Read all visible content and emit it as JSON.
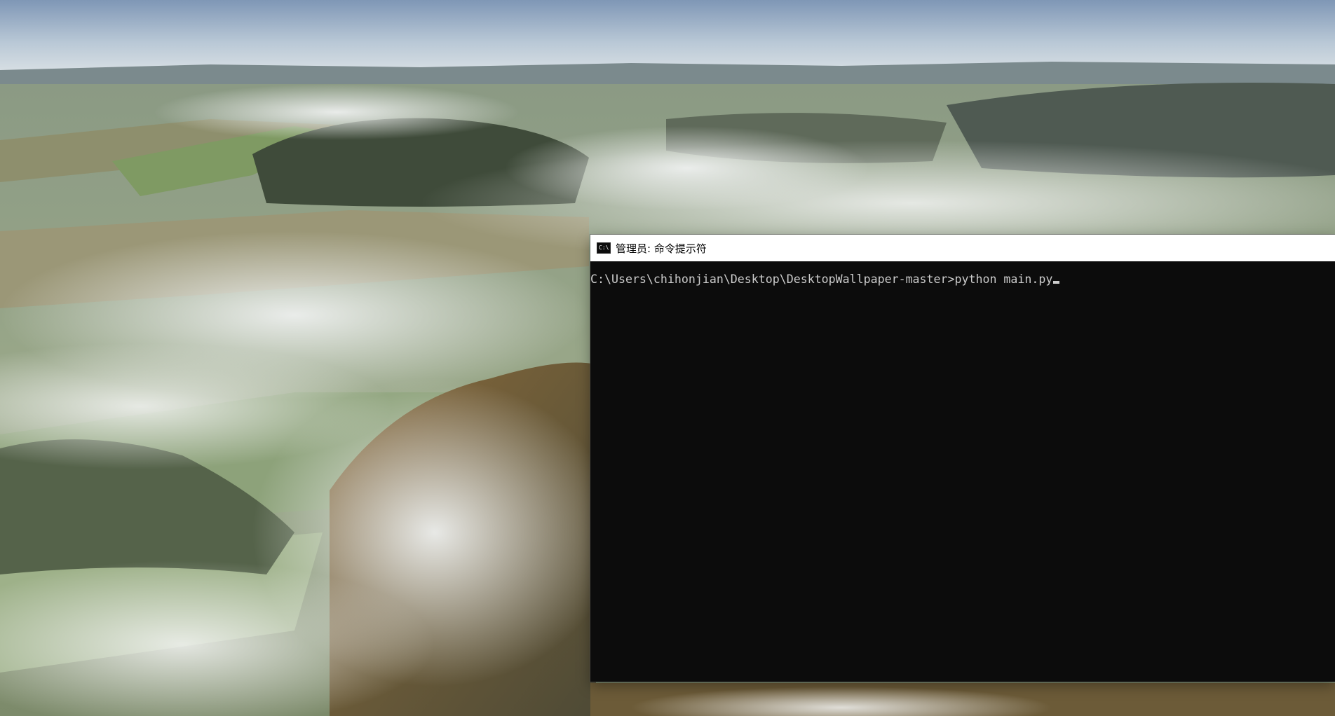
{
  "desktop": {
    "wallpaper_icon": "landscape-photo"
  },
  "cmd_window": {
    "title": "管理员: 命令提示符",
    "icon_label": "C:\\",
    "prompt": "C:\\Users\\chihonjian\\Desktop\\DesktopWallpaper-master>",
    "command": "python main.py",
    "colors": {
      "console_bg": "#0c0c0c",
      "console_text": "#cccccc",
      "titlebar_bg": "#ffffff"
    }
  }
}
